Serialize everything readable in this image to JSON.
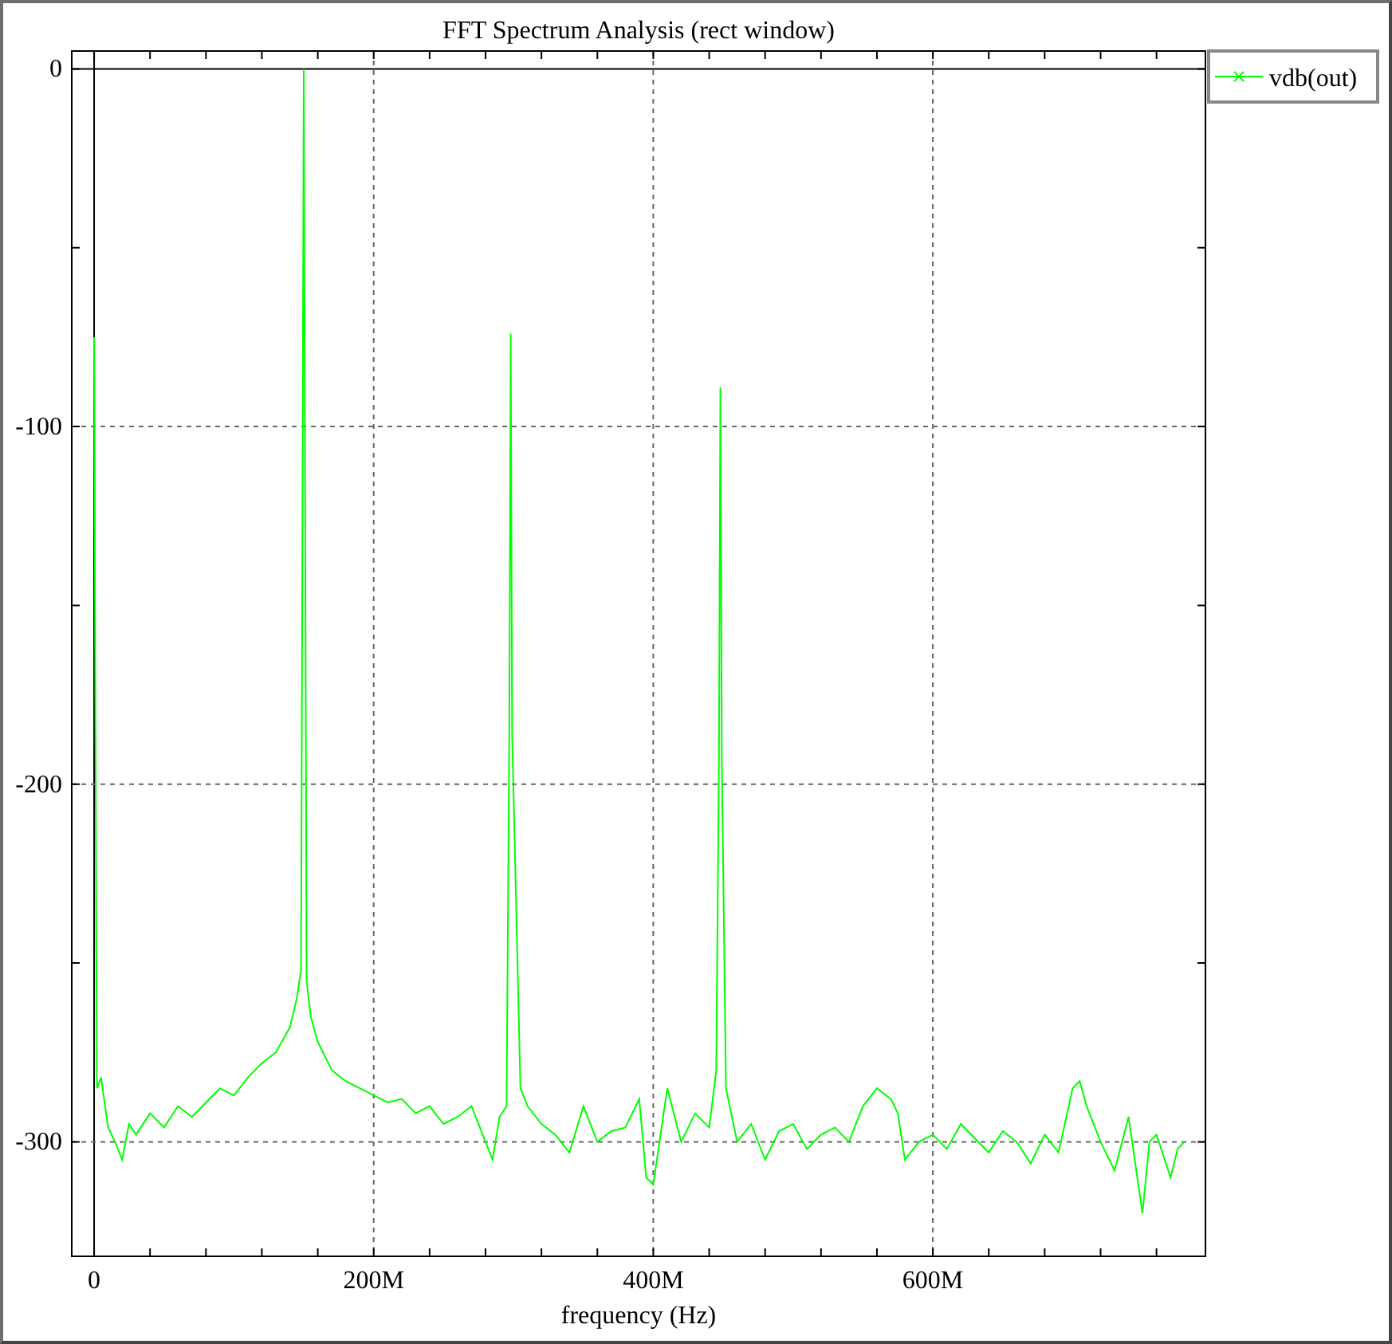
{
  "plot": {
    "chart_data": {
      "type": "line",
      "grid": true,
      "title": "FFT Spectrum Analysis (rect window)",
      "xlabel": "frequency (Hz)",
      "xlim": [
        -16,
        795
      ],
      "ylim": [
        -332,
        5
      ],
      "xticks": [
        {
          "value": 0,
          "label": "0"
        },
        {
          "value": 200,
          "label": "200M"
        },
        {
          "value": 400,
          "label": "400M"
        },
        {
          "value": 600,
          "label": "600M"
        }
      ],
      "yticks": [
        0,
        -100,
        -200,
        -300
      ],
      "x": [
        0,
        1,
        2,
        5,
        10,
        15,
        20,
        25,
        30,
        40,
        50,
        60,
        70,
        80,
        90,
        100,
        110,
        120,
        130,
        140,
        145,
        148,
        149,
        150,
        151,
        152,
        155,
        160,
        170,
        180,
        190,
        200,
        210,
        220,
        230,
        240,
        250,
        260,
        270,
        280,
        285,
        290,
        295,
        297,
        298,
        299,
        305,
        310,
        320,
        330,
        340,
        350,
        360,
        370,
        380,
        390,
        395,
        400,
        410,
        420,
        430,
        440,
        445,
        447,
        448,
        449,
        452,
        460,
        470,
        480,
        490,
        500,
        510,
        520,
        530,
        540,
        550,
        560,
        570,
        575,
        580,
        590,
        600,
        610,
        620,
        630,
        640,
        650,
        660,
        670,
        680,
        690,
        700,
        705,
        710,
        720,
        730,
        740,
        750,
        755,
        760,
        770,
        775,
        780
      ],
      "series": [
        {
          "name": "vdb(out)",
          "color": "#00ff00",
          "values": [
            -75,
            -187,
            -285,
            -282,
            -296,
            -300,
            -305,
            -295,
            -298,
            -292,
            -296,
            -290,
            -293,
            -289,
            -285,
            -287,
            -282,
            -278,
            -275,
            -268,
            -260,
            -252,
            -125,
            0,
            -126,
            -255,
            -265,
            -272,
            -280,
            -283,
            -285,
            -287,
            -289,
            -288,
            -292,
            -290,
            -295,
            -293,
            -290,
            -300,
            -305,
            -293,
            -290,
            -185,
            -74,
            -186,
            -285,
            -290,
            -295,
            -298,
            -303,
            -290,
            -300,
            -297,
            -296,
            -288,
            -310,
            -312,
            -285,
            -300,
            -292,
            -296,
            -280,
            -192,
            -89,
            -193,
            -285,
            -300,
            -295,
            -305,
            -297,
            -295,
            -302,
            -298,
            -296,
            -300,
            -290,
            -285,
            -288,
            -292,
            -305,
            -300,
            -298,
            -302,
            -295,
            -299,
            -303,
            -297,
            -300,
            -306,
            -298,
            -303,
            -285,
            -283,
            -290,
            -300,
            -308,
            -293,
            -320,
            -300,
            -298,
            -310,
            -302,
            -300
          ]
        }
      ]
    }
  }
}
